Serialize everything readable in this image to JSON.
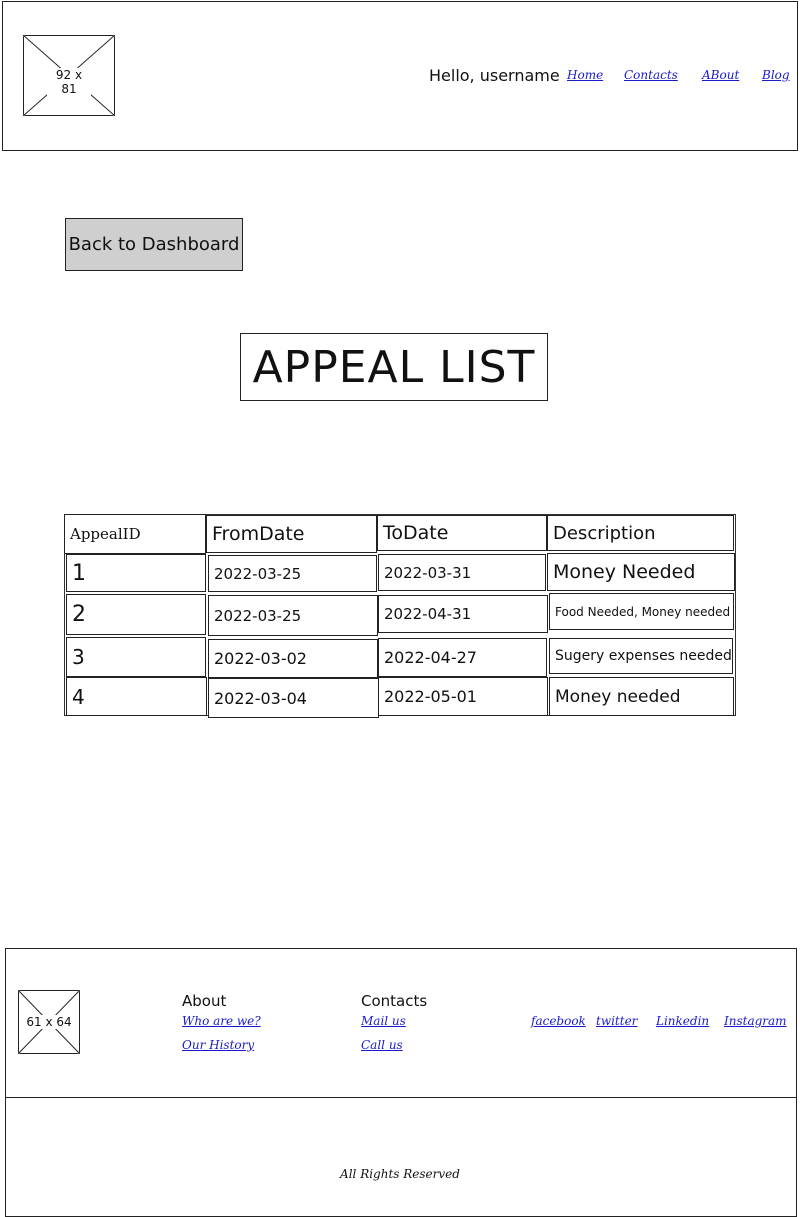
{
  "header": {
    "logo_placeholder": "92 x 81",
    "greeting": "Hello, username",
    "nav": [
      "Home",
      "Contacts",
      "ABout",
      "Blog"
    ]
  },
  "back_button": "Back to Dashboard",
  "page_title": "APPEAL LIST",
  "table": {
    "columns": [
      "AppealID",
      "FromDate",
      "ToDate",
      "Description"
    ],
    "rows": [
      [
        "1",
        "2022-03-25",
        "2022-03-31",
        "Money Needed"
      ],
      [
        "2",
        "2022-03-25",
        "2022-04-31",
        "Food Needed, Money needed"
      ],
      [
        "3",
        "2022-03-02",
        "2022-04-27",
        "Sugery expenses needed"
      ],
      [
        "4",
        "2022-03-04",
        "2022-05-01",
        "Money needed"
      ]
    ]
  },
  "footer": {
    "logo_placeholder": "61 x 64",
    "about": {
      "heading": "About",
      "links": [
        "Who are we?",
        "Our History"
      ]
    },
    "contacts": {
      "heading": "Contacts",
      "links": [
        "Mail us",
        "Call us"
      ]
    },
    "social": [
      "facebook",
      "twitter",
      "Linkedin",
      "Instagram"
    ],
    "rights": "All Rights Reserved"
  }
}
